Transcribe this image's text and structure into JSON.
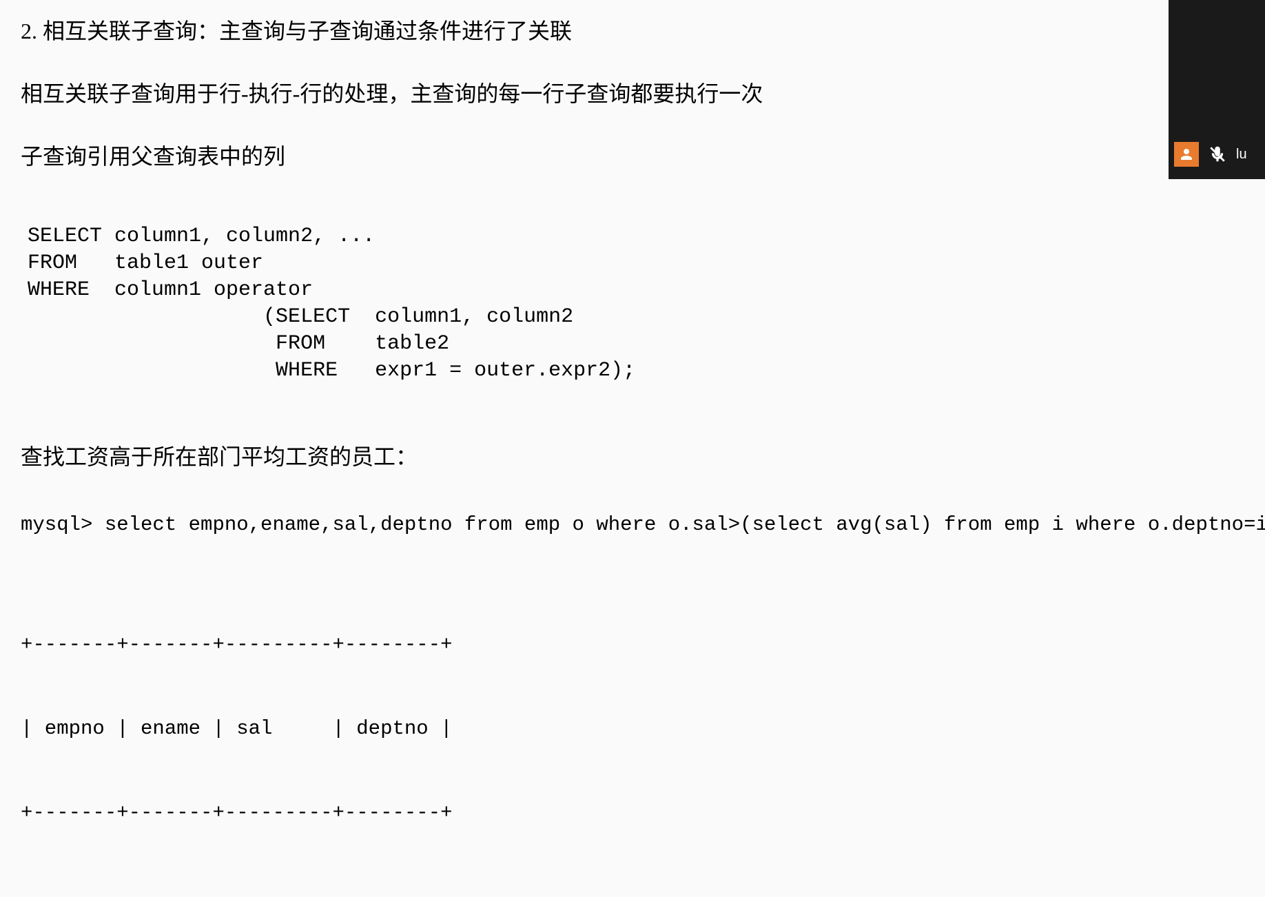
{
  "doc": {
    "heading": "2. 相互关联子查询：主查询与子查询通过条件进行了关联",
    "para1": "相互关联子查询用于行-执行-行的处理，主查询的每一行子查询都要执行一次",
    "para2": "子查询引用父查询表中的列",
    "code_syntax": "SELECT column1, column2, ...\nFROM   table1 outer\nWHERE  column1 operator\n                   (SELECT  column1, column2\n                    FROM    table2\n                    WHERE   expr1 = outer.expr2);",
    "query_heading": "查找工资高于所在部门平均工资的员工：",
    "mysql_line": "mysql> select empno,ename,sal,deptno from emp o where o.sal>(select avg(sal) from emp i where o.deptno=i.deptno);",
    "table_border_top": "+-------+-------+---------+--------+",
    "table_header": "| empno | ename | sal     | deptno |",
    "table_border_mid": "+-------+-------+---------+--------+",
    "table_columns": [
      "empno",
      "ename",
      "sal",
      "deptno"
    ]
  },
  "overlay": {
    "user_label": "lu"
  }
}
